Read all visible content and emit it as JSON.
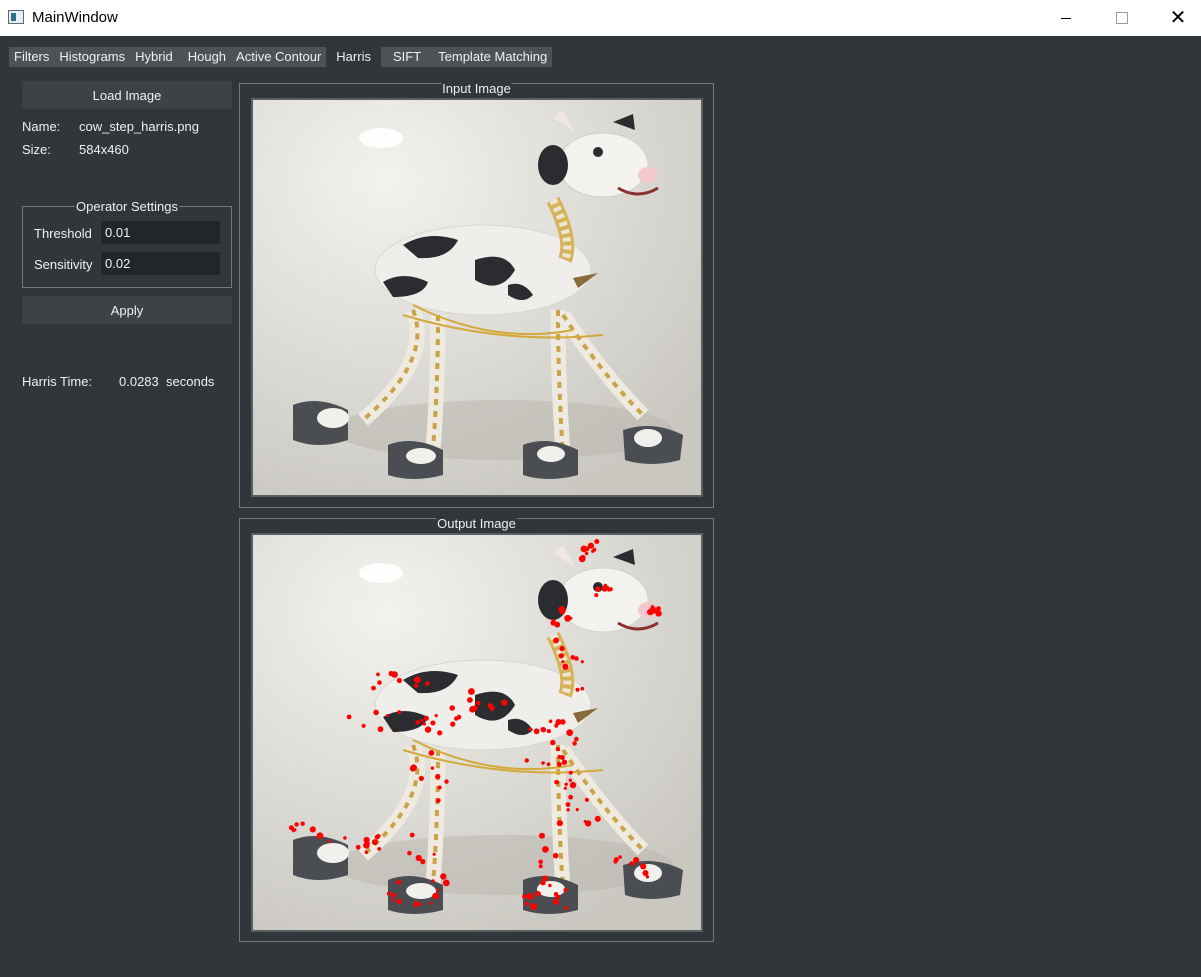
{
  "window": {
    "title": "MainWindow"
  },
  "tabs": [
    {
      "label": "Filters"
    },
    {
      "label": "Histograms"
    },
    {
      "label": "Hybrid"
    },
    {
      "label": "Hough"
    },
    {
      "label": "Active Contour"
    },
    {
      "label": "Harris"
    },
    {
      "label": "SIFT"
    },
    {
      "label": "Template Matching"
    }
  ],
  "active_tab": "Harris",
  "left_panel": {
    "load_button": "Load Image",
    "name_label": "Name:",
    "name_value": "cow_step_harris.png",
    "size_label": "Size:",
    "size_value": "584x460",
    "operator_settings": {
      "title": "Operator Settings",
      "threshold_label": "Threshold",
      "threshold_value": "0.01",
      "sensitivity_label": "Sensitivity",
      "sensitivity_value": "0.02"
    },
    "apply_button": "Apply",
    "time_label": "Harris Time:",
    "time_value": "0.0283",
    "time_unit": "seconds"
  },
  "input_panel": {
    "title": "Input Image"
  },
  "output_panel": {
    "title": "Output Image"
  },
  "colors": {
    "background": "#31363b",
    "corner_marker": "#ff0000"
  }
}
